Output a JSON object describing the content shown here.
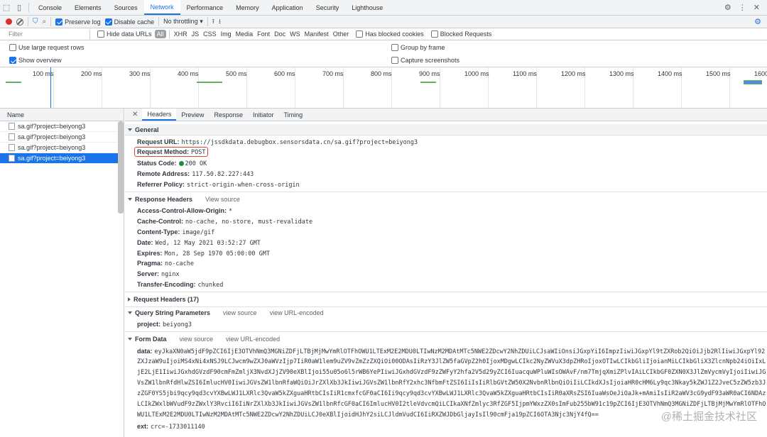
{
  "top_tabs": [
    "Console",
    "Elements",
    "Sources",
    "Network",
    "Performance",
    "Memory",
    "Application",
    "Security",
    "Lighthouse"
  ],
  "active_tab": "Network",
  "toolbar": {
    "preserve_log": "Preserve log",
    "disable_cache": "Disable cache",
    "throttle": "No throttling"
  },
  "filter": {
    "placeholder": "Filter",
    "hide_data_urls": "Hide data URLs",
    "all": "All",
    "types": [
      "XHR",
      "JS",
      "CSS",
      "Img",
      "Media",
      "Font",
      "Doc",
      "WS",
      "Manifest",
      "Other"
    ],
    "has_blocked_cookies": "Has blocked cookies",
    "blocked_requests": "Blocked Requests"
  },
  "options": {
    "large_rows": "Use large request rows",
    "group_by_frame": "Group by frame",
    "show_overview": "Show overview",
    "capture_screenshots": "Capture screenshots"
  },
  "overview_ticks": [
    "100 ms",
    "200 ms",
    "300 ms",
    "400 ms",
    "500 ms",
    "600 ms",
    "700 ms",
    "800 ms",
    "900 ms",
    "1000 ms",
    "1100 ms",
    "1200 ms",
    "1300 ms",
    "1400 ms",
    "1500 ms",
    "1600"
  ],
  "request_list": {
    "header": "Name",
    "rows": [
      "sa.gif?project=beiyong3",
      "sa.gif?project=beiyong3",
      "sa.gif?project=beiyong3",
      "sa.gif?project=beiyong3"
    ],
    "selected_index": 3
  },
  "detail_tabs": [
    "Headers",
    "Preview",
    "Response",
    "Initiator",
    "Timing"
  ],
  "active_detail_tab": "Headers",
  "general": {
    "title": "General",
    "request_url_label": "Request URL:",
    "request_url": "https://jssdkdata.debugbox.sensorsdata.cn/sa.gif?project=beiyong3",
    "request_method_label": "Request Method:",
    "request_method": "POST",
    "status_code_label": "Status Code:",
    "status_code": "200 OK",
    "remote_address_label": "Remote Address:",
    "remote_address": "117.50.82.227:443",
    "referrer_policy_label": "Referrer Policy:",
    "referrer_policy": "strict-origin-when-cross-origin"
  },
  "response_headers": {
    "title": "Response Headers",
    "view_source": "View source",
    "items": [
      {
        "k": "Access-Control-Allow-Origin:",
        "v": "*"
      },
      {
        "k": "Cache-Control:",
        "v": "no-cache, no-store, must-revalidate"
      },
      {
        "k": "Content-Type:",
        "v": "image/gif"
      },
      {
        "k": "Date:",
        "v": "Wed, 12 May 2021 03:52:27 GMT"
      },
      {
        "k": "Expires:",
        "v": "Mon, 28 Sep 1970 05:00:00 GMT"
      },
      {
        "k": "Pragma:",
        "v": "no-cache"
      },
      {
        "k": "Server:",
        "v": "nginx"
      },
      {
        "k": "Transfer-Encoding:",
        "v": "chunked"
      }
    ]
  },
  "request_headers": {
    "title": "Request Headers (17)"
  },
  "query_params": {
    "title": "Query String Parameters",
    "view_source": "view source",
    "view_url_encoded": "view URL-encoded",
    "project_label": "project:",
    "project_value": "beiyong3"
  },
  "form_data": {
    "title": "Form Data",
    "view_source": "view source",
    "view_url_encoded": "view URL-encoded",
    "data_label": "data:",
    "data_lines": [
      "eyJkaXN0aW5jdF9pZCI6IjE3OTVhNmQ3MGNiZDFjLTBjMjMwYmRlOTFhOWU1LTExM2E2MDU0LTIwNzM2MDAtMTc5NWE2ZDcwY2NhZDUiLCJsaWIiOnsiJGxpYiI6ImpzIiwiJGxpYl9tZXRob2QiOiJjb2RlIiwiJGxpYl92",
      "ZXJzaW9uIjoiMS4xNi4xNSJ9LCJwcm9wZXJ0aWVzIjp7IiR0aW1lem9uZV9vZmZzZXQiOi00ODAsIiRzY3JlZW5faGVpZ2h0IjoxMDgwLCIkc2NyZWVuX3dpZHRoIjoxOTIwLCIkbGliIjoianMiLCIkbGliX3ZlcnNpb24iOiIxL",
      "jE2LjE1IiwiJGxhdGVzdF90cmFmZmljX3NvdXJjZV90eXBlIjoi55u05o6l5rWB6YePIiwiJGxhdGVzdF9zZWFyY2hfa2V5d29yZCI6IuacquWPluWIsOWAvF/nm7TmjqXmiZPlvIAiLCIkbGF0ZXN0X3JlZmVycmVyIjoiIiwiJG",
      "VsZW1lbnRfdHlwZSI6ImlucHV0IiwiJGVsZW1lbnRfaWQiOiJrZXlXb3JkIiwiJGVsZW1lbnRfY2xhc3NfbmFtZSI6IiIsIiRlbGVtZW50X2NvbnRlbnQiOiIiLCIkdXJsIjoiaHR0cHM6Ly9qc3Nkay5kZWJ1Z2JveC5zZW5zb3J",
      "zZGF0YS5jbi9qcy9qd3cvYXBwLWJ1LXRlc3QvaW5kZXguaHRtbCIsIiR1cmxfcGF0aCI6Ii9qcy9qd3cvYXBwLWJ1LXRlc3QvaW5kZXguaHRtbCIsIiR0aXRsZSI6IuaWsOeJiOaJk+mAmiIsIiR2aWV3cG9ydF93aWR0aCI6NDAz",
      "LCIkZWxlbWVudF9zZWxlY3RvciI6IiNrZXlXb3JkIiwiJGVsZW1lbnRfcGF0aCI6ImlucHV0I2tleVdvcmQiLCIkaXNfZmlyc3RfZGF5IjpmYWxzZX0sImFub255bW91c19pZCI6IjE3OTVhNmQ3MGNiZDFjLTBjMjMwYmRlOTFhO",
      "WU1LTExM2E2MDU0LTIwNzM2MDAtMTc5NWE2ZDcwY2NhZDUiLCJ0eXBlIjoidHJhY2siLCJldmVudCI6IiRXZWJDbGljayIsIl90cmFja19pZCI6OTA3Njc3NjY4fQ=="
    ],
    "ext_label": "ext:",
    "ext_value": "crc=-1733011140"
  },
  "watermark": "@稀土掘金技术社区"
}
